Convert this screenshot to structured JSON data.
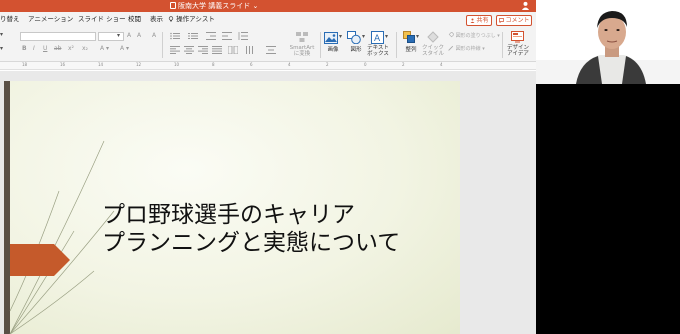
{
  "window": {
    "title": "阪南大学 講義スライド ⌄"
  },
  "menu": {
    "items": [
      {
        "label": "り替え"
      },
      {
        "label": "アニメーション"
      },
      {
        "label": "スライド ショー"
      },
      {
        "label": "校閲"
      },
      {
        "label": "表示"
      },
      {
        "label": "操作アシスト"
      }
    ],
    "share_label": "共有",
    "comment_label": "コメント"
  },
  "ribbon": {
    "smartart_label": "SmartArt\nに変換",
    "image_label": "画像",
    "shape_label": "図形",
    "textbox_label": "テキスト\nボックス",
    "arrange_label": "整列",
    "quickstyle_label": "クイック\nスタイル",
    "fill_label": "図形の塗りつぶし",
    "outline_label": "図形の枠線",
    "designer_label": "デザイン\nアイデア"
  },
  "slide": {
    "title_line1": "プロ野球選手のキャリア",
    "title_line2": "プランニングと実態について"
  },
  "colors": {
    "accent": "#d35230",
    "slide_arrow": "#c55a2b",
    "slide_bar": "#5a5046"
  },
  "icons": [
    "user-icon",
    "doc-icon",
    "share-icon",
    "comment-icon",
    "image-icon",
    "shape-icon",
    "textbox-icon",
    "arrange-icon",
    "quickstyle-icon",
    "designer-icon"
  ]
}
